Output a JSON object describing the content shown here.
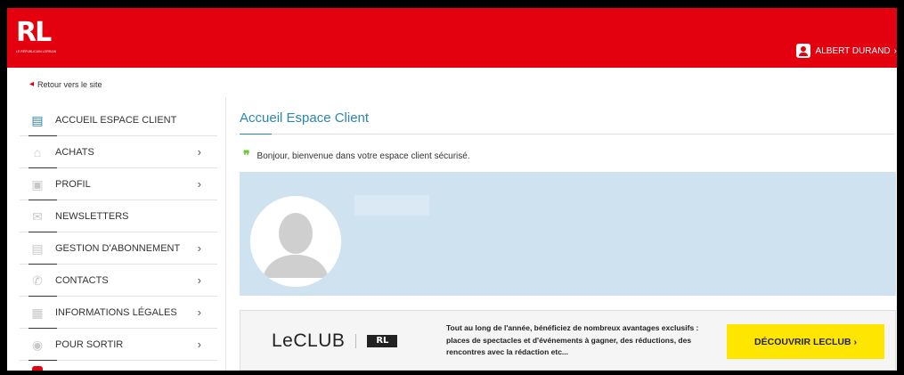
{
  "header": {
    "logo_text": "RL",
    "logo_subtitle": "LE RÉPUBLICAIN LORRAIN",
    "user_name": "ALBERT DURAND",
    "user_chevron": "›",
    "brand_color": "#e3000f"
  },
  "back_link": {
    "arrow": "◂",
    "label": "Retour vers le site"
  },
  "sidebar": {
    "items": [
      {
        "label": "ACCUEIL ESPACE CLIENT",
        "icon": "id-card-icon",
        "glyph": "▤",
        "chevron": ""
      },
      {
        "label": "ACHATS",
        "icon": "basket-icon",
        "glyph": "⌂",
        "chevron": "›"
      },
      {
        "label": "PROFIL",
        "icon": "profile-icon",
        "glyph": "▣",
        "chevron": "›"
      },
      {
        "label": "NEWSLETTERS",
        "icon": "envelope-icon",
        "glyph": "✉",
        "chevron": ""
      },
      {
        "label": "GESTION D'ABONNEMENT",
        "icon": "newspaper-icon",
        "glyph": "▤",
        "chevron": "›"
      },
      {
        "label": "CONTACTS",
        "icon": "phone-icon",
        "glyph": "✆",
        "chevron": "›"
      },
      {
        "label": "INFORMATIONS LÉGALES",
        "icon": "document-icon",
        "glyph": "▦",
        "chevron": "›"
      },
      {
        "label": "POUR SORTIR",
        "icon": "globe-icon",
        "glyph": "◉",
        "chevron": "›"
      }
    ],
    "active_color": "#2a86b3"
  },
  "main": {
    "title": "Accueil Espace Client",
    "welcome_quote": "❞",
    "welcome_text": "Bonjour, bienvenue dans votre espace client sécurisé.",
    "panel_color": "#cfe2f0"
  },
  "club": {
    "name": "LeCLUB",
    "badge": "RL",
    "text": "Tout au long de l'année, bénéficiez de nombreux avantages exclusifs : places de spectacles et d'événements à gagner, des réductions, des rencontres avec la rédaction etc...",
    "cta": "DÉCOUVRIR LECLUB ›",
    "cta_color": "#ffe600"
  }
}
